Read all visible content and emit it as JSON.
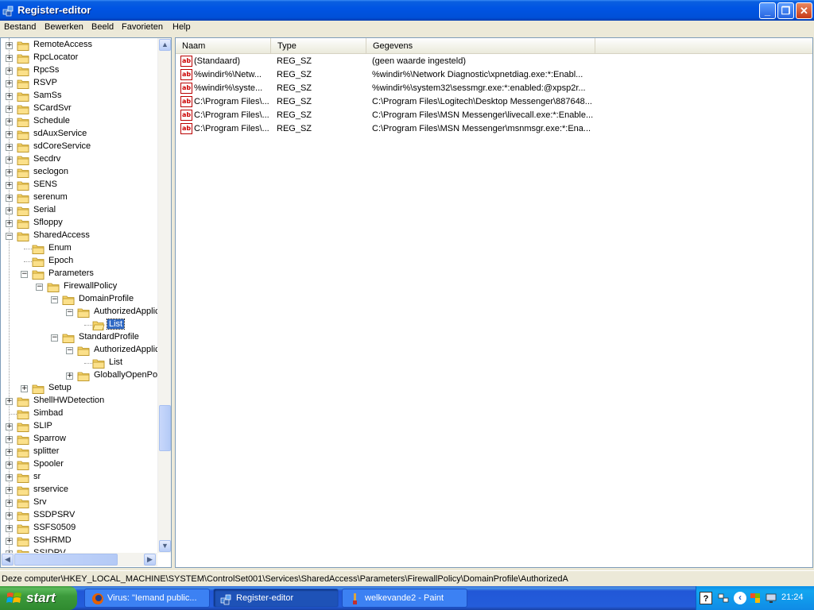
{
  "window": {
    "title": "Register-editor",
    "min": "_",
    "max": "❐",
    "close": "✕"
  },
  "menu": [
    "Bestand",
    "Bewerken",
    "Beeld",
    "Favorieten",
    "Help"
  ],
  "tree": [
    {
      "label": "RemoteAccess",
      "level": 0,
      "expander": "+"
    },
    {
      "label": "RpcLocator",
      "level": 0,
      "expander": "+"
    },
    {
      "label": "RpcSs",
      "level": 0,
      "expander": "+"
    },
    {
      "label": "RSVP",
      "level": 0,
      "expander": "+"
    },
    {
      "label": "SamSs",
      "level": 0,
      "expander": "+"
    },
    {
      "label": "SCardSvr",
      "level": 0,
      "expander": "+"
    },
    {
      "label": "Schedule",
      "level": 0,
      "expander": "+"
    },
    {
      "label": "sdAuxService",
      "level": 0,
      "expander": "+"
    },
    {
      "label": "sdCoreService",
      "level": 0,
      "expander": "+"
    },
    {
      "label": "Secdrv",
      "level": 0,
      "expander": "+"
    },
    {
      "label": "seclogon",
      "level": 0,
      "expander": "+"
    },
    {
      "label": "SENS",
      "level": 0,
      "expander": "+"
    },
    {
      "label": "serenum",
      "level": 0,
      "expander": "+"
    },
    {
      "label": "Serial",
      "level": 0,
      "expander": "+"
    },
    {
      "label": "Sfloppy",
      "level": 0,
      "expander": "+"
    },
    {
      "label": "SharedAccess",
      "level": 0,
      "expander": "−"
    },
    {
      "label": "Enum",
      "level": 1,
      "expander": ""
    },
    {
      "label": "Epoch",
      "level": 1,
      "expander": ""
    },
    {
      "label": "Parameters",
      "level": 1,
      "expander": "−"
    },
    {
      "label": "FirewallPolicy",
      "level": 2,
      "expander": "−"
    },
    {
      "label": "DomainProfile",
      "level": 3,
      "expander": "−"
    },
    {
      "label": "AuthorizedApplic",
      "level": 4,
      "expander": "−"
    },
    {
      "label": "List",
      "level": 5,
      "expander": "",
      "selected": true
    },
    {
      "label": "StandardProfile",
      "level": 3,
      "expander": "−"
    },
    {
      "label": "AuthorizedApplic",
      "level": 4,
      "expander": "−"
    },
    {
      "label": "List",
      "level": 5,
      "expander": ""
    },
    {
      "label": "GloballyOpenPor",
      "level": 4,
      "expander": "+"
    },
    {
      "label": "Setup",
      "level": 1,
      "expander": "+"
    },
    {
      "label": "ShellHWDetection",
      "level": 0,
      "expander": "+"
    },
    {
      "label": "Simbad",
      "level": 0,
      "expander": ""
    },
    {
      "label": "SLIP",
      "level": 0,
      "expander": "+"
    },
    {
      "label": "Sparrow",
      "level": 0,
      "expander": "+"
    },
    {
      "label": "splitter",
      "level": 0,
      "expander": "+"
    },
    {
      "label": "Spooler",
      "level": 0,
      "expander": "+"
    },
    {
      "label": "sr",
      "level": 0,
      "expander": "+"
    },
    {
      "label": "srservice",
      "level": 0,
      "expander": "+"
    },
    {
      "label": "Srv",
      "level": 0,
      "expander": "+"
    },
    {
      "label": "SSDPSRV",
      "level": 0,
      "expander": "+"
    },
    {
      "label": "SSFS0509",
      "level": 0,
      "expander": "+"
    },
    {
      "label": "SSHRMD",
      "level": 0,
      "expander": "+"
    },
    {
      "label": "SSIDRV",
      "level": 0,
      "expander": "+"
    }
  ],
  "list": {
    "columns": [
      "Naam",
      "Type",
      "Gegevens"
    ],
    "rows": [
      {
        "name": "(Standaard)",
        "type": "REG_SZ",
        "data": "(geen waarde ingesteld)"
      },
      {
        "name": "%windir%\\Netw...",
        "type": "REG_SZ",
        "data": "%windir%\\Network Diagnostic\\xpnetdiag.exe:*:Enabl..."
      },
      {
        "name": "%windir%\\syste...",
        "type": "REG_SZ",
        "data": "%windir%\\system32\\sessmgr.exe:*:enabled:@xpsp2r..."
      },
      {
        "name": "C:\\Program Files\\...",
        "type": "REG_SZ",
        "data": "C:\\Program Files\\Logitech\\Desktop Messenger\\887648..."
      },
      {
        "name": "C:\\Program Files\\...",
        "type": "REG_SZ",
        "data": "C:\\Program Files\\MSN Messenger\\livecall.exe:*:Enable..."
      },
      {
        "name": "C:\\Program Files\\...",
        "type": "REG_SZ",
        "data": "C:\\Program Files\\MSN Messenger\\msnmsgr.exe:*:Ena..."
      }
    ]
  },
  "status": "Deze computer\\HKEY_LOCAL_MACHINE\\SYSTEM\\ControlSet001\\Services\\SharedAccess\\Parameters\\FirewallPolicy\\DomainProfile\\AuthorizedA",
  "taskbar": {
    "start": "start",
    "tasks": [
      {
        "label": "Virus: \"Iemand public...",
        "active": false
      },
      {
        "label": "Register-editor",
        "active": true
      },
      {
        "label": "welkevande2 - Paint",
        "active": false
      }
    ],
    "help": "?",
    "clock": "21:24"
  },
  "colors": {
    "selected": "#316ac5",
    "titlebar": "#0054e3",
    "taskbar": "#245ddb",
    "start": "#3c9a3c"
  }
}
